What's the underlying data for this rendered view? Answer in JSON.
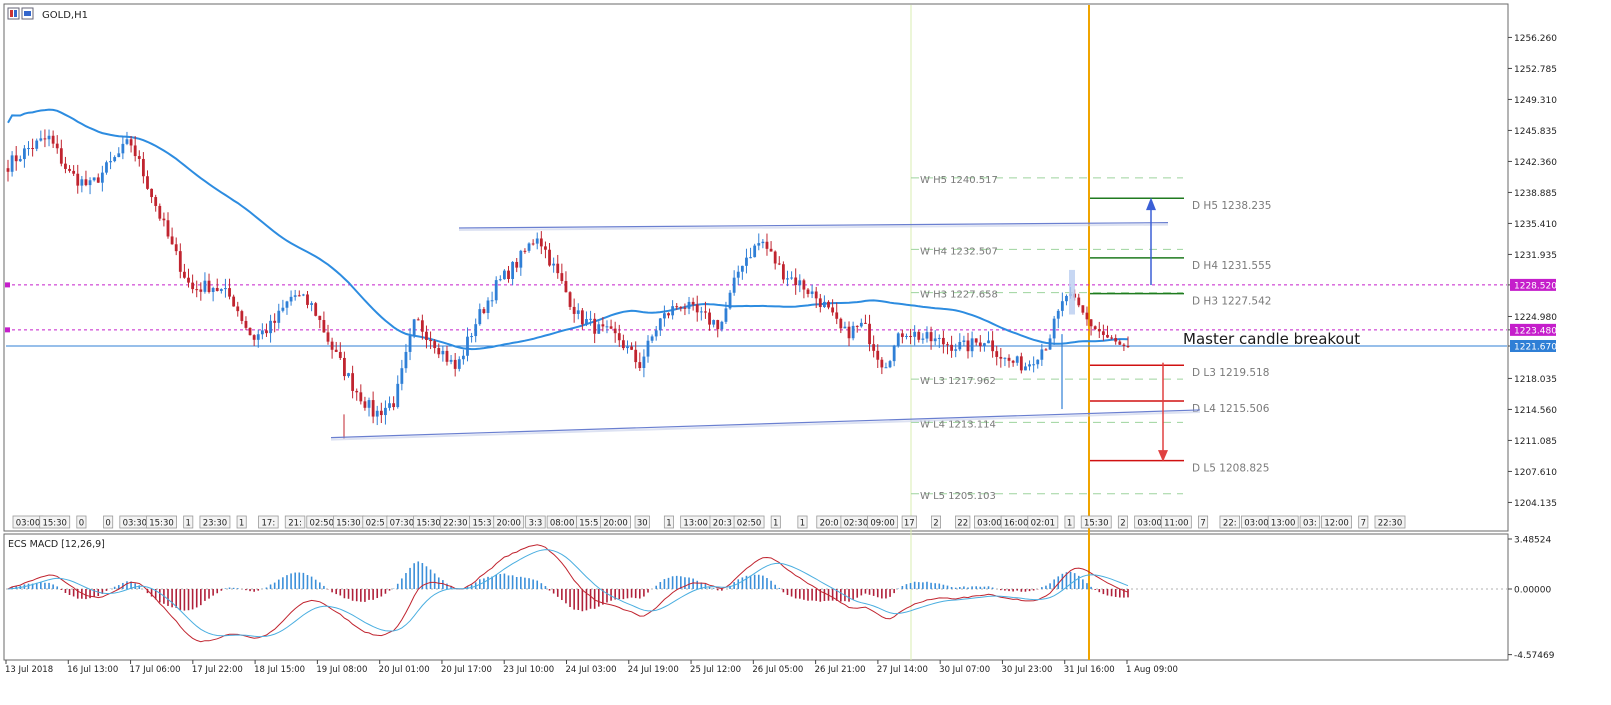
{
  "window": {
    "symbol_title": "GOLD,H1"
  },
  "subwindow": {
    "title": "ECS MACD [12,26,9]"
  },
  "annotation": "Master candle breakout",
  "colors": {
    "bull": "#2f7fd6",
    "bear": "#c0242f",
    "ma": "#2d8ce0",
    "magenta": "#c51ecb",
    "current_line": "#2f7fd6",
    "orange": "#f0a400",
    "green_levels": "#1f7a1f",
    "red_levels": "#d01010",
    "weekly": "#9dd49d",
    "macd_signal": "#4aaee0",
    "macd_main": "#c0242f"
  },
  "price_axis": {
    "ticks": [
      "1256.260",
      "1252.785",
      "1249.310",
      "1245.835",
      "1242.360",
      "1238.885",
      "1235.410",
      "1231.935",
      "1228.520",
      "1224.980",
      "1223.480",
      "1221.670",
      "1218.035",
      "1214.560",
      "1211.085",
      "1207.610",
      "1204.135"
    ],
    "flags": [
      {
        "text": "1228.520",
        "kind": "magenta"
      },
      {
        "text": "1223.480",
        "kind": "magenta"
      },
      {
        "text": "1221.670",
        "kind": "current"
      }
    ]
  },
  "macd_axis": {
    "ticks": [
      "3.48524",
      "0.00000",
      "-4.57469"
    ]
  },
  "time_axis": [
    "13 Jul 2018",
    "16 Jul 13:00",
    "17 Jul 06:00",
    "17 Jul 22:00",
    "18 Jul 15:00",
    "19 Jul 08:00",
    "20 Jul 01:00",
    "20 Jul 17:00",
    "23 Jul 10:00",
    "24 Jul 03:00",
    "24 Jul 19:00",
    "25 Jul 12:00",
    "26 Jul 05:00",
    "26 Jul 21:00",
    "27 Jul 14:00",
    "30 Jul 07:00",
    "30 Jul 23:00",
    "31 Jul 16:00",
    "1 Aug 09:00"
  ],
  "session_labels": [
    "03:00",
    "15:30",
    "0",
    "0",
    "03:30",
    "15:30",
    "1",
    "23:30",
    "1",
    "17:",
    "21:",
    "02:50",
    "15:30",
    "02:5",
    "07:30",
    "15:30",
    "22:30",
    "15:3",
    "20:00",
    "3:3",
    "08:00",
    "15:5",
    "20:00",
    "30",
    "1",
    "13:00",
    "20:3",
    "02:50",
    "1",
    "1",
    "20:0",
    "02:30",
    "09:00",
    "17",
    "2",
    "22",
    "03:00",
    "16:00",
    "02:01",
    "1",
    "15:30",
    "2",
    "03:00",
    "11:00",
    "7",
    "22:",
    "03:00",
    "13:00",
    "03:",
    "12:00",
    "7",
    "22:30"
  ],
  "weekly_levels": [
    {
      "text": "W  H5 1240.517"
    },
    {
      "text": "W  H4 1232.507"
    },
    {
      "text": "W  H3 1227.658"
    },
    {
      "text": "W  L3 1217.962"
    },
    {
      "text": "W  L4 1213.114"
    },
    {
      "text": "W  L5 1205.103"
    }
  ],
  "daily_levels": [
    {
      "text": "D  H5 1238.235",
      "color": "green"
    },
    {
      "text": "D  H4 1231.555",
      "color": "green"
    },
    {
      "text": "D  H3 1227.542",
      "color": "green"
    },
    {
      "text": "D  L3 1219.518",
      "color": "red"
    },
    {
      "text": "D  L4 1215.506",
      "color": "red"
    },
    {
      "text": "D  L5 1208.825",
      "color": "red"
    }
  ],
  "chart_data": {
    "type": "candlestick",
    "symbol": "GOLD",
    "timeframe": "H1",
    "ylim": [
      1202.9,
      1259.5
    ],
    "ma_period_note": "",
    "trendlines": [
      {
        "from": [
          "20 Jul 17:00",
          1234.9
        ],
        "to": [
          "31 Jul 16:00",
          1235.5
        ]
      },
      {
        "from": [
          "19 Jul 08:00",
          1211.4
        ],
        "to": [
          "1 Aug 09:00",
          1214.5
        ]
      }
    ],
    "levels": {
      "weekly": [
        1240.517,
        1232.507,
        1227.658,
        1217.962,
        1213.114,
        1205.103
      ],
      "daily": [
        1238.235,
        1231.555,
        1227.542,
        1219.518,
        1215.506,
        1208.825
      ],
      "magenta": [
        1228.52,
        1223.48
      ],
      "current": 1221.67
    },
    "anchors_close": [
      1242.0,
      1243.8,
      1245.0,
      1241.0,
      1239.5,
      1242.0,
      1244.6,
      1239.0,
      1233.0,
      1228.0,
      1228.5,
      1227.0,
      1222.5,
      1224.0,
      1227.5,
      1226.0,
      1221.0,
      1217.0,
      1214.0,
      1215.5,
      1224.5,
      1222.0,
      1219.0,
      1224.5,
      1228.5,
      1231.0,
      1234.2,
      1229.5,
      1225.0,
      1223.5,
      1222.5,
      1219.5,
      1224.5,
      1226.5,
      1225.0,
      1224.0,
      1231.0,
      1233.5,
      1230.0,
      1228.5,
      1226.5,
      1223.0,
      1224.0,
      1219.5,
      1223.5,
      1222.5,
      1222.0,
      1221.5,
      1222.5,
      1220.0,
      1219.5,
      1222.0,
      1227.5,
      1224.5,
      1222.5,
      1221.0
    ],
    "macd_ylim": [
      -4.57469,
      3.48524
    ]
  }
}
